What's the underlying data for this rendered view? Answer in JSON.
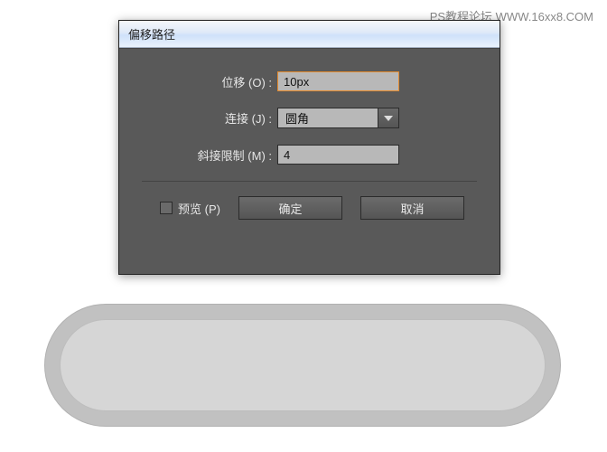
{
  "watermark": "PS教程论坛 WWW.16xx8.COM",
  "dialog": {
    "title": "偏移路径",
    "offset": {
      "label": "位移 (O) :",
      "value": "10px"
    },
    "join": {
      "label": "连接 (J) :",
      "value": "圆角"
    },
    "miter": {
      "label": "斜接限制 (M) :",
      "value": "4"
    },
    "preview": {
      "label": "预览 (P)",
      "checked": false
    },
    "buttons": {
      "ok": "确定",
      "cancel": "取消"
    }
  }
}
